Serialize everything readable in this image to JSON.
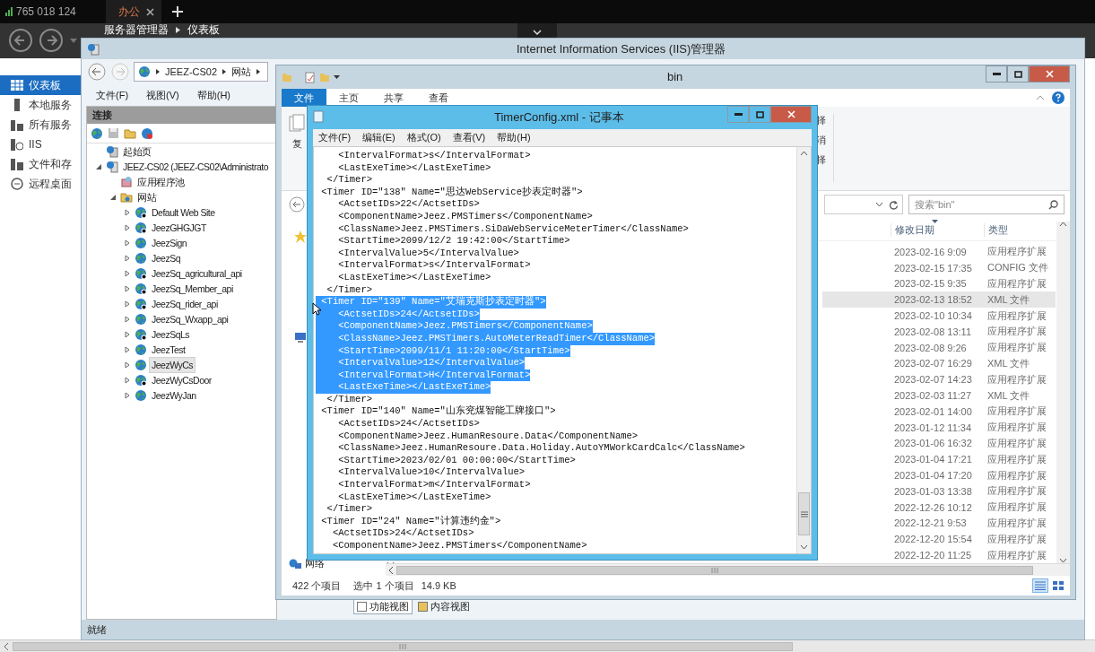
{
  "tab_bar": {
    "signal_text": "765 018 124",
    "tabs": [
      {
        "label": "办公",
        "selected": true
      }
    ]
  },
  "server_manager": {
    "breadcrumb": [
      "服务器管理器",
      "仪表板"
    ],
    "sidebar": [
      {
        "label": "仪表板",
        "kind": "dashboard",
        "selected": true
      },
      {
        "label": "本地服务",
        "kind": "local",
        "selected": false
      },
      {
        "label": "所有服务",
        "kind": "all",
        "selected": false
      },
      {
        "label": "IIS",
        "kind": "iis",
        "selected": false
      },
      {
        "label": "文件和存",
        "kind": "files",
        "selected": false
      },
      {
        "label": "远程桌面",
        "kind": "remote",
        "selected": false
      }
    ]
  },
  "iis": {
    "title": "Internet Information Services (IIS)管理器",
    "address": [
      "JEEZ-CS02",
      "网站"
    ],
    "menu": [
      "文件(F)",
      "视图(V)",
      "帮助(H)"
    ],
    "connections": {
      "title": "连接",
      "tree": [
        {
          "label": "起始页",
          "kind": "start",
          "selected": false
        },
        {
          "label": "JEEZ-CS02 (JEEZ-CS02\\Administrato",
          "kind": "server",
          "expanded": true,
          "selected": false,
          "children": [
            {
              "label": "应用程序池",
              "kind": "pool",
              "selected": false
            },
            {
              "label": "网站",
              "kind": "sites",
              "expanded": true,
              "selected": false,
              "children": [
                {
                  "label": "Default Web Site",
                  "kind": "site",
                  "expanded": false,
                  "stopped": true,
                  "selected": false
                },
                {
                  "label": "JeezGHGJGT",
                  "kind": "site",
                  "expanded": false,
                  "stopped": true,
                  "selected": false
                },
                {
                  "label": "JeezSign",
                  "kind": "site",
                  "expanded": false,
                  "stopped": false,
                  "selected": false
                },
                {
                  "label": "JeezSq",
                  "kind": "site",
                  "expanded": false,
                  "stopped": false,
                  "selected": false
                },
                {
                  "label": "JeezSq_agricultural_api",
                  "kind": "site",
                  "expanded": false,
                  "stopped": true,
                  "selected": false
                },
                {
                  "label": "JeezSq_Member_api",
                  "kind": "site",
                  "expanded": false,
                  "stopped": true,
                  "selected": false
                },
                {
                  "label": "JeezSq_rider_api",
                  "kind": "site",
                  "expanded": false,
                  "stopped": true,
                  "selected": false
                },
                {
                  "label": "JeezSq_Wxapp_api",
                  "kind": "site",
                  "expanded": false,
                  "stopped": false,
                  "selected": false
                },
                {
                  "label": "JeezSqLs",
                  "kind": "site",
                  "expanded": false,
                  "stopped": true,
                  "selected": false
                },
                {
                  "label": "JeezTest",
                  "kind": "site",
                  "expanded": false,
                  "stopped": false,
                  "selected": false
                },
                {
                  "label": "JeezWyCs",
                  "kind": "site",
                  "expanded": false,
                  "stopped": false,
                  "selected": true
                },
                {
                  "label": "JeezWyCsDoor",
                  "kind": "site",
                  "expanded": false,
                  "stopped": true,
                  "selected": false
                },
                {
                  "label": "JeezWyJan",
                  "kind": "site",
                  "expanded": false,
                  "stopped": false,
                  "selected": false
                }
              ]
            }
          ]
        }
      ]
    },
    "view_tabs": [
      {
        "label": "功能视图",
        "selected": true
      },
      {
        "label": "内容视图",
        "selected": false
      }
    ],
    "status": "就绪"
  },
  "explorer": {
    "title": "bin",
    "ribbon_tabs": [
      {
        "label": "文件",
        "selected": true
      },
      {
        "label": "主页",
        "selected": false
      },
      {
        "label": "共享",
        "selected": false
      },
      {
        "label": "查看",
        "selected": false
      }
    ],
    "ribbon_left_label": "复",
    "ribbon_right_labels": [
      "择",
      "消",
      "择"
    ],
    "search": {
      "placeholder": "搜索\"bin\""
    },
    "columns": [
      "修改日期",
      "类型"
    ],
    "files": [
      {
        "modified": "2023-02-16 9:09",
        "type": "应用程序扩展",
        "selected": false
      },
      {
        "modified": "2023-02-15 17:35",
        "type": "CONFIG 文件",
        "selected": false
      },
      {
        "modified": "2023-02-15 9:35",
        "type": "应用程序扩展",
        "selected": false
      },
      {
        "modified": "2023-02-13 18:52",
        "type": "XML 文件",
        "selected": true
      },
      {
        "modified": "2023-02-10 10:34",
        "type": "应用程序扩展",
        "selected": false
      },
      {
        "modified": "2023-02-08 13:11",
        "type": "应用程序扩展",
        "selected": false
      },
      {
        "modified": "2023-02-08 9:26",
        "type": "应用程序扩展",
        "selected": false
      },
      {
        "modified": "2023-02-07 16:29",
        "type": "XML 文件",
        "selected": false
      },
      {
        "modified": "2023-02-07 14:23",
        "type": "应用程序扩展",
        "selected": false
      },
      {
        "modified": "2023-02-03 11:27",
        "type": "XML 文件",
        "selected": false
      },
      {
        "modified": "2023-02-01 14:00",
        "type": "应用程序扩展",
        "selected": false
      },
      {
        "modified": "2023-01-12 11:34",
        "type": "应用程序扩展",
        "selected": false
      },
      {
        "modified": "2023-01-06 16:32",
        "type": "应用程序扩展",
        "selected": false
      },
      {
        "modified": "2023-01-04 17:21",
        "type": "应用程序扩展",
        "selected": false
      },
      {
        "modified": "2023-01-04 17:20",
        "type": "应用程序扩展",
        "selected": false
      },
      {
        "modified": "2023-01-03 13:38",
        "type": "应用程序扩展",
        "selected": false
      },
      {
        "modified": "2022-12-26 10:12",
        "type": "应用程序扩展",
        "selected": false
      },
      {
        "modified": "2022-12-21 9:53",
        "type": "应用程序扩展",
        "selected": false
      },
      {
        "modified": "2022-12-20 15:54",
        "type": "应用程序扩展",
        "selected": false
      },
      {
        "modified": "2022-12-20 11:25",
        "type": "应用程序扩展",
        "selected": false
      }
    ],
    "nav_item": "网络",
    "status": {
      "count": "422 个项目",
      "selection": "选中 1 个项目",
      "size": "14.9 KB"
    },
    "views": [
      {
        "kind": "details",
        "selected": true
      },
      {
        "kind": "tiles",
        "selected": false
      }
    ]
  },
  "notepad": {
    "title": "TimerConfig.xml - 记事本",
    "menu": [
      "文件(F)",
      "编辑(E)",
      "格式(O)",
      "查看(V)",
      "帮助(H)"
    ],
    "lines": [
      {
        "text": "    <IntervalFormat>s</IntervalFormat>",
        "selected": false
      },
      {
        "text": "    <LastExeTime></LastExeTime>",
        "selected": false
      },
      {
        "text": "  </Timer>",
        "selected": false
      },
      {
        "text": " <Timer ID=\"138\" Name=\"思达WebService抄表定时器\">",
        "selected": false
      },
      {
        "text": "    <ActsetIDs>22</ActsetIDs>",
        "selected": false
      },
      {
        "text": "    <ComponentName>Jeez.PMSTimers</ComponentName>",
        "selected": false
      },
      {
        "text": "    <ClassName>Jeez.PMSTimers.SiDaWebServiceMeterTimer</ClassName>",
        "selected": false
      },
      {
        "text": "    <StartTime>2099/12/2 19:42:00</StartTime>",
        "selected": false
      },
      {
        "text": "    <IntervalValue>5</IntervalValue>",
        "selected": false
      },
      {
        "text": "    <IntervalFormat>s</IntervalFormat>",
        "selected": false
      },
      {
        "text": "    <LastExeTime></LastExeTime>",
        "selected": false
      },
      {
        "text": "  </Timer>",
        "selected": false
      },
      {
        "text": " <Timer ID=\"139\" Name=\"艾瑞克斯抄表定时器\">",
        "selected": true
      },
      {
        "text": "    <ActsetIDs>24</ActsetIDs>",
        "selected": true
      },
      {
        "text": "    <ComponentName>Jeez.PMSTimers</ComponentName>",
        "selected": true
      },
      {
        "text": "    <ClassName>Jeez.PMSTimers.AutoMeterReadTimer</ClassName>",
        "selected": true
      },
      {
        "text": "    <StartTime>2099/11/1 11:20:00</StartTime>",
        "selected": true
      },
      {
        "text": "    <IntervalValue>12</IntervalValue>",
        "selected": true
      },
      {
        "text": "    <IntervalFormat>H</IntervalFormat>",
        "selected": true
      },
      {
        "text": "    <LastExeTime></LastExeTime>",
        "selected": true
      },
      {
        "text": "  </Timer>",
        "selected": false
      },
      {
        "text": " <Timer ID=\"140\" Name=\"山东兖煤智能工牌接口\">",
        "selected": false
      },
      {
        "text": "    <ActsetIDs>24</ActsetIDs>",
        "selected": false
      },
      {
        "text": "    <ComponentName>Jeez.HumanResoure.Data</ComponentName>",
        "selected": false
      },
      {
        "text": "    <ClassName>Jeez.HumanResoure.Data.Holiday.AutoYMWorkCardCalc</ClassName>",
        "selected": false
      },
      {
        "text": "    <StartTime>2023/02/01 00:00:00</StartTime>",
        "selected": false
      },
      {
        "text": "    <IntervalValue>10</IntervalValue>",
        "selected": false
      },
      {
        "text": "    <IntervalFormat>m</IntervalFormat>",
        "selected": false
      },
      {
        "text": "    <LastExeTime></LastExeTime>",
        "selected": false
      },
      {
        "text": "  </Timer>",
        "selected": false
      },
      {
        "text": " <Timer ID=\"24\" Name=\"计算违约金\">",
        "selected": false
      },
      {
        "text": "   <ActsetIDs>24</ActsetIDs>",
        "selected": false
      },
      {
        "text": "   <ComponentName>Jeez.PMSTimers</ComponentName>",
        "selected": false
      }
    ]
  }
}
